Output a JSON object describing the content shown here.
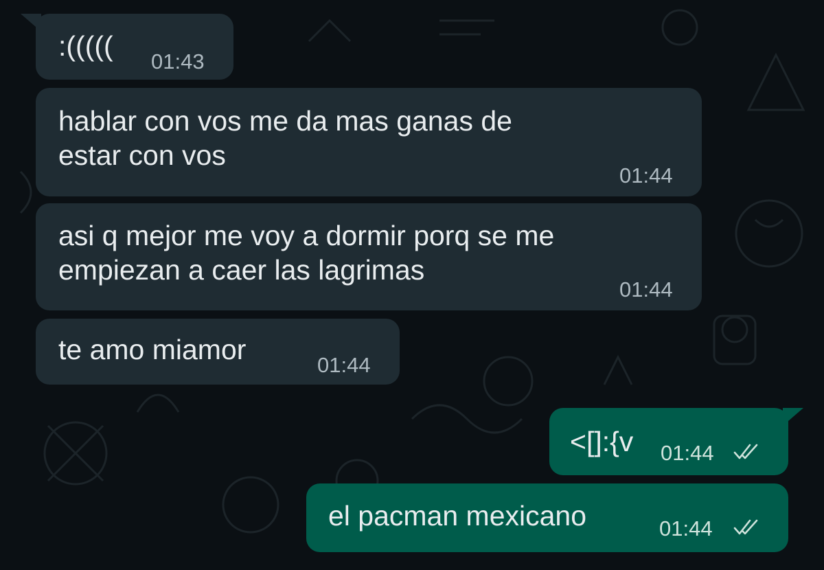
{
  "messages": [
    {
      "direction": "incoming",
      "text": ":(((((",
      "time": "01:43",
      "tail": true
    },
    {
      "direction": "incoming",
      "text": "hablar con vos me da mas ganas de\nestar con vos",
      "time": "01:44"
    },
    {
      "direction": "incoming",
      "text": "asi q mejor me voy a dormir porq se me\nempiezan a caer las lagrimas",
      "time": "01:44"
    },
    {
      "direction": "incoming",
      "text": "te amo miamor",
      "time": "01:44"
    },
    {
      "direction": "outgoing",
      "text": "<[]:{v",
      "time": "01:44",
      "status": "read",
      "tail": true
    },
    {
      "direction": "outgoing",
      "text": "el pacman mexicano",
      "time": "01:44",
      "status": "read"
    }
  ],
  "colors": {
    "background": "#0b1014",
    "incoming_bubble": "#1f2c33",
    "outgoing_bubble": "#005c4b",
    "text": "#e9edef",
    "timestamp": "#aebac1",
    "read_ticks": "#cfe3dc"
  },
  "icons": {
    "read_receipt": "double-check-icon"
  }
}
